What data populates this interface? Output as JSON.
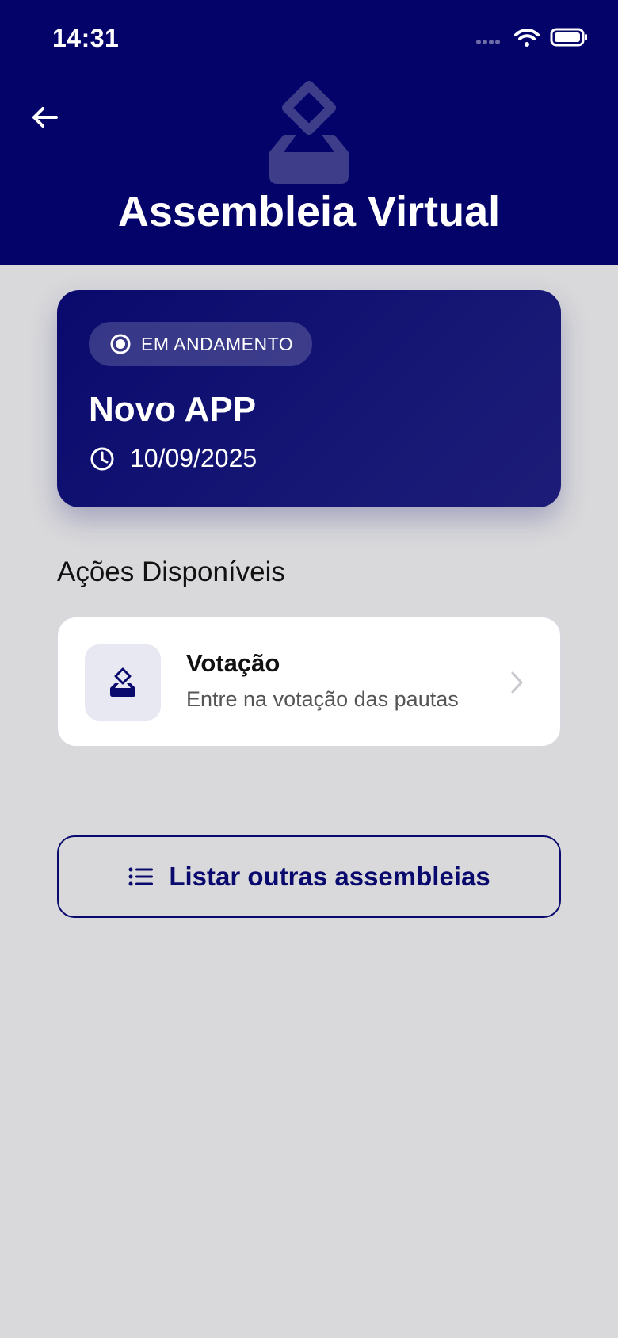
{
  "status_bar": {
    "time": "14:31"
  },
  "header": {
    "title": "Assembleia Virtual"
  },
  "meeting": {
    "status": "EM ANDAMENTO",
    "name": "Novo APP",
    "date": "10/09/2025"
  },
  "actions": {
    "section_title": "Ações Disponíveis",
    "items": [
      {
        "title": "Votação",
        "subtitle": "Entre na votação das pautas"
      }
    ]
  },
  "list_button": {
    "label": "Listar outras assembleias"
  },
  "icons": {
    "back": "back-arrow-icon",
    "hero": "ballot-box-icon",
    "status": "radio-dot-icon",
    "clock": "clock-icon",
    "action": "ballot-box-icon",
    "chevron": "chevron-right-icon",
    "list": "list-icon",
    "wifi": "wifi-icon",
    "battery": "battery-icon",
    "signal": "cellular-signal-icon"
  },
  "colors": {
    "primary": "#03036A",
    "background": "#D9D9DB",
    "card": "#FFFFFF",
    "muted_text": "#555555"
  }
}
